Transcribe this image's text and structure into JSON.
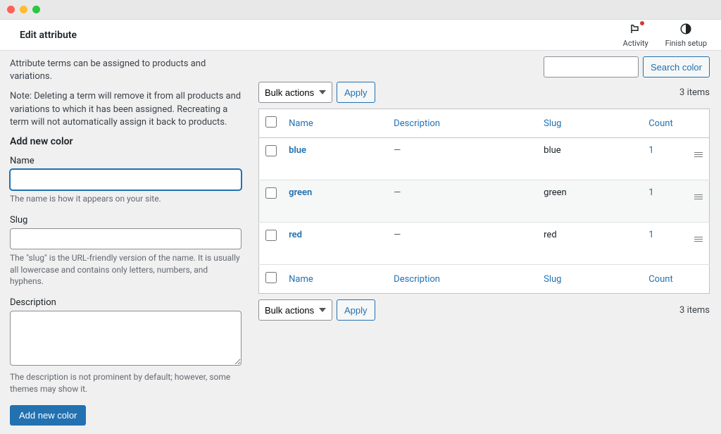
{
  "topbar": {
    "title": "Edit attribute",
    "activity": "Activity",
    "finish_setup": "Finish setup"
  },
  "left": {
    "intro": "Attribute terms can be assigned to products and variations.",
    "note": "Note: Deleting a term will remove it from all products and variations to which it has been assigned. Recreating a term will not automatically assign it back to products.",
    "heading": "Add new color",
    "name_label": "Name",
    "name_help": "The name is how it appears on your site.",
    "slug_label": "Slug",
    "slug_help": "The \"slug\" is the URL-friendly version of the name. It is usually all lowercase and contains only letters, numbers, and hyphens.",
    "desc_label": "Description",
    "desc_help": "The description is not prominent by default; however, some themes may show it.",
    "submit": "Add new color"
  },
  "right": {
    "search_button": "Search color",
    "bulk_actions": "Bulk actions",
    "apply": "Apply",
    "items_count": "3 items",
    "headers": {
      "name": "Name",
      "description": "Description",
      "slug": "Slug",
      "count": "Count"
    },
    "rows": [
      {
        "name": "blue",
        "description": "—",
        "slug": "blue",
        "count": "1"
      },
      {
        "name": "green",
        "description": "—",
        "slug": "green",
        "count": "1"
      },
      {
        "name": "red",
        "description": "—",
        "slug": "red",
        "count": "1"
      }
    ]
  }
}
